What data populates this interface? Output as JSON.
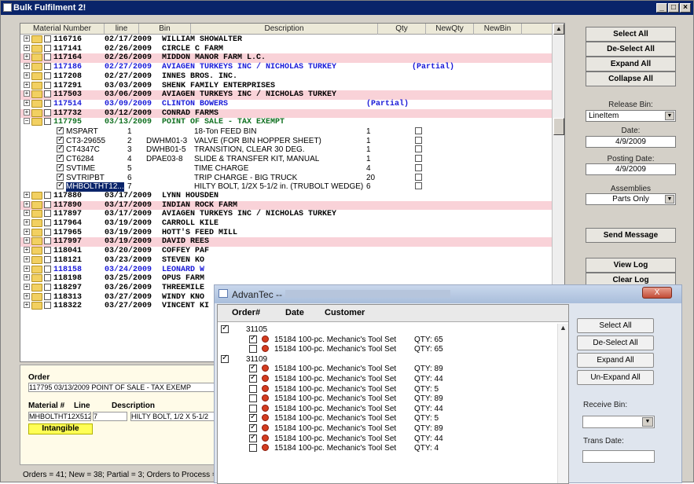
{
  "window": {
    "title": "Bulk Fulfilment 2!"
  },
  "grid": {
    "columns": [
      "Material Number",
      "line",
      "Bin",
      "Description",
      "Qty",
      "NewQty",
      "NewBin"
    ],
    "orders": [
      {
        "num": "116716",
        "date": "02/17/2009",
        "customer": "WILLIAM SHOWALTER",
        "style": "",
        "pink": false,
        "partial": ""
      },
      {
        "num": "117141",
        "date": "02/26/2009",
        "customer": "CIRCLE C FARM",
        "style": "",
        "pink": false,
        "partial": ""
      },
      {
        "num": "117164",
        "date": "02/26/2009",
        "customer": "MIDDON MANOR FARM L.C.",
        "style": "",
        "pink": true,
        "partial": ""
      },
      {
        "num": "117186",
        "date": "02/27/2009",
        "customer": "AVIAGEN TURKEYS INC / NICHOLAS TURKEY",
        "style": "blue",
        "pink": false,
        "partial": "(Partial)"
      },
      {
        "num": "117208",
        "date": "02/27/2009",
        "customer": "INNES BROS. INC.",
        "style": "",
        "pink": false,
        "partial": ""
      },
      {
        "num": "117291",
        "date": "03/03/2009",
        "customer": "SHENK FAMILY ENTERPRISES",
        "style": "",
        "pink": false,
        "partial": ""
      },
      {
        "num": "117503",
        "date": "03/06/2009",
        "customer": "AVIAGEN TURKEYS INC / NICHOLAS TURKEY",
        "style": "",
        "pink": true,
        "partial": ""
      },
      {
        "num": "117514",
        "date": "03/09/2009",
        "customer": "CLINTON BOWERS",
        "style": "blue",
        "pink": false,
        "partial": "(Partial)"
      },
      {
        "num": "117732",
        "date": "03/12/2009",
        "customer": "CONRAD FARMS",
        "style": "",
        "pink": true,
        "partial": ""
      },
      {
        "num": "117795",
        "date": "03/13/2009",
        "customer": "POINT OF SALE - TAX EXEMPT",
        "style": "green",
        "pink": false,
        "partial": ""
      }
    ],
    "items": [
      {
        "material": "MSPART",
        "line": "1",
        "bin": "",
        "desc": "18-Ton FEED BIN",
        "qty": "1"
      },
      {
        "material": "CT3-29655",
        "line": "2",
        "bin": "DWHM01-3",
        "desc": "VALVE (FOR BIN HOPPER SHEET)",
        "qty": "1"
      },
      {
        "material": "CT4347C",
        "line": "3",
        "bin": "DWHB01-5",
        "desc": "TRANSITION, CLEAR 30 DEG.",
        "qty": "1"
      },
      {
        "material": "CT6284",
        "line": "4",
        "bin": "DPAE03-8",
        "desc": "SLIDE & TRANSFER KIT, MANUAL",
        "qty": "1"
      },
      {
        "material": "SVTIME",
        "line": "5",
        "bin": "",
        "desc": "TIME CHARGE",
        "qty": "4"
      },
      {
        "material": "SVTRIPBT",
        "line": "6",
        "bin": "",
        "desc": "TRIP CHARGE - BIG TRUCK",
        "qty": "20"
      },
      {
        "material": "MHBOLTHT12...",
        "line": "7",
        "bin": "",
        "desc": "HILTY BOLT, 1/2X 5-1/2 in. (TRUBOLT WEDGE)",
        "qty": "6"
      }
    ],
    "orders2": [
      {
        "num": "117880",
        "date": "03/17/2009",
        "customer": "LYNN HOUSDEN",
        "style": "",
        "pink": false
      },
      {
        "num": "117890",
        "date": "03/17/2009",
        "customer": "INDIAN ROCK FARM",
        "style": "",
        "pink": true
      },
      {
        "num": "117897",
        "date": "03/17/2009",
        "customer": "AVIAGEN TURKEYS INC / NICHOLAS TURKEY",
        "style": "",
        "pink": false
      },
      {
        "num": "117964",
        "date": "03/19/2009",
        "customer": "CARROLL KILE",
        "style": "",
        "pink": false
      },
      {
        "num": "117965",
        "date": "03/19/2009",
        "customer": "HOTT'S FEED MILL",
        "style": "",
        "pink": false
      },
      {
        "num": "117997",
        "date": "03/19/2009",
        "customer": "DAVID REES",
        "style": "",
        "pink": true
      },
      {
        "num": "118041",
        "date": "03/20/2009",
        "customer": "COFFEY PAF",
        "style": "",
        "pink": false
      },
      {
        "num": "118121",
        "date": "03/23/2009",
        "customer": "STEVEN KO",
        "style": "",
        "pink": false
      },
      {
        "num": "118158",
        "date": "03/24/2009",
        "customer": "LEONARD W",
        "style": "blue",
        "pink": false
      },
      {
        "num": "118198",
        "date": "03/25/2009",
        "customer": "OPUS FARM",
        "style": "",
        "pink": false
      },
      {
        "num": "118297",
        "date": "03/26/2009",
        "customer": "THREEMILE",
        "style": "",
        "pink": false
      },
      {
        "num": "118313",
        "date": "03/27/2009",
        "customer": "WINDY KNO",
        "style": "",
        "pink": false
      },
      {
        "num": "118322",
        "date": "03/27/2009",
        "customer": "VINCENT KI",
        "style": "",
        "pink": false
      }
    ]
  },
  "right_panel": {
    "select_all": "Select All",
    "deselect_all": "De-Select All",
    "expand_all": "Expand All",
    "collapse_all": "Collapse All",
    "release_bin_label": "Release Bin:",
    "release_bin_value": "LineItem",
    "date_label": "Date:",
    "date_value": "4/9/2009",
    "posting_date_label": "Posting Date:",
    "posting_date_value": "4/9/2009",
    "assemblies_label": "Assemblies",
    "assemblies_value": "Parts Only",
    "send_message": "Send Message",
    "view_log": "View Log",
    "clear_log": "Clear Log"
  },
  "detail": {
    "order_label": "Order",
    "order_value": "117795    03/13/2009   POINT OF SALE - TAX EXEMP",
    "material_label": "Material #",
    "line_label": "Line",
    "description_label": "Description",
    "material_value": "MHBOLTHT12X512",
    "line_value": "7",
    "description_value": "HILTY BOLT, 1/2 X 5-1/2",
    "intangible": "Intangible"
  },
  "status": "Orders = 41; New = 38; Partial = 3; Orders to Process =",
  "dialog": {
    "title": "AdvanTec --",
    "close": "X",
    "columns": [
      "Order#",
      "Date",
      "Customer"
    ],
    "rows": [
      {
        "type": "order",
        "text": "31105",
        "checked": true
      },
      {
        "type": "item",
        "text": "15184 100-pc. Mechanic's Tool Set",
        "qty": "QTY: 65",
        "checked": true
      },
      {
        "type": "item",
        "text": "15184 100-pc. Mechanic's Tool Set",
        "qty": "QTY: 65",
        "checked": false
      },
      {
        "type": "order",
        "text": "31109",
        "checked": true
      },
      {
        "type": "item",
        "text": "15184 100-pc. Mechanic's Tool Set",
        "qty": "QTY: 89",
        "checked": true
      },
      {
        "type": "item",
        "text": "15184 100-pc. Mechanic's Tool Set",
        "qty": "QTY: 44",
        "checked": true
      },
      {
        "type": "item",
        "text": "15184 100-pc. Mechanic's Tool Set",
        "qty": "QTY: 5",
        "checked": false
      },
      {
        "type": "item",
        "text": "15184 100-pc. Mechanic's Tool Set",
        "qty": "QTY: 89",
        "checked": false
      },
      {
        "type": "item",
        "text": "15184 100-pc. Mechanic's Tool Set",
        "qty": "QTY: 44",
        "checked": false
      },
      {
        "type": "item",
        "text": "15184 100-pc. Mechanic's Tool Set",
        "qty": "QTY: 5",
        "checked": true
      },
      {
        "type": "item",
        "text": "15184 100-pc. Mechanic's Tool Set",
        "qty": "QTY: 89",
        "checked": true
      },
      {
        "type": "item",
        "text": "15184 100-pc. Mechanic's Tool Set",
        "qty": "QTY: 44",
        "checked": true
      },
      {
        "type": "item",
        "text": "15184 100-pc. Mechanic's Tool Set",
        "qty": "QTY: 4",
        "checked": false
      }
    ],
    "select_all": "Select All",
    "deselect_all": "De-Select All",
    "expand_all": "Expand All",
    "unexpand_all": "Un-Expand All",
    "receive_bin_label": "Receive Bin:",
    "trans_date_label": "Trans Date:"
  }
}
